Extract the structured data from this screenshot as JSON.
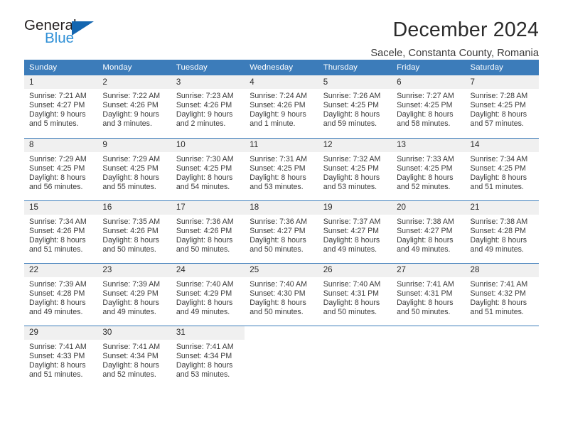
{
  "brand": {
    "logo_general": "General",
    "logo_blue": "Blue",
    "accent_color": "#3c7cba",
    "logo_blue_color": "#2e8fd6",
    "logo_triangle_color": "#1466b0"
  },
  "header": {
    "title": "December 2024",
    "subtitle": "Sacele, Constanta County, Romania"
  },
  "calendar": {
    "weekday_headers": [
      "Sunday",
      "Monday",
      "Tuesday",
      "Wednesday",
      "Thursday",
      "Friday",
      "Saturday"
    ],
    "weeks": [
      [
        {
          "day": "1",
          "sunrise": "Sunrise: 7:21 AM",
          "sunset": "Sunset: 4:27 PM",
          "daylight_line1": "Daylight: 9 hours",
          "daylight_line2": "and 5 minutes."
        },
        {
          "day": "2",
          "sunrise": "Sunrise: 7:22 AM",
          "sunset": "Sunset: 4:26 PM",
          "daylight_line1": "Daylight: 9 hours",
          "daylight_line2": "and 3 minutes."
        },
        {
          "day": "3",
          "sunrise": "Sunrise: 7:23 AM",
          "sunset": "Sunset: 4:26 PM",
          "daylight_line1": "Daylight: 9 hours",
          "daylight_line2": "and 2 minutes."
        },
        {
          "day": "4",
          "sunrise": "Sunrise: 7:24 AM",
          "sunset": "Sunset: 4:26 PM",
          "daylight_line1": "Daylight: 9 hours",
          "daylight_line2": "and 1 minute."
        },
        {
          "day": "5",
          "sunrise": "Sunrise: 7:26 AM",
          "sunset": "Sunset: 4:25 PM",
          "daylight_line1": "Daylight: 8 hours",
          "daylight_line2": "and 59 minutes."
        },
        {
          "day": "6",
          "sunrise": "Sunrise: 7:27 AM",
          "sunset": "Sunset: 4:25 PM",
          "daylight_line1": "Daylight: 8 hours",
          "daylight_line2": "and 58 minutes."
        },
        {
          "day": "7",
          "sunrise": "Sunrise: 7:28 AM",
          "sunset": "Sunset: 4:25 PM",
          "daylight_line1": "Daylight: 8 hours",
          "daylight_line2": "and 57 minutes."
        }
      ],
      [
        {
          "day": "8",
          "sunrise": "Sunrise: 7:29 AM",
          "sunset": "Sunset: 4:25 PM",
          "daylight_line1": "Daylight: 8 hours",
          "daylight_line2": "and 56 minutes."
        },
        {
          "day": "9",
          "sunrise": "Sunrise: 7:29 AM",
          "sunset": "Sunset: 4:25 PM",
          "daylight_line1": "Daylight: 8 hours",
          "daylight_line2": "and 55 minutes."
        },
        {
          "day": "10",
          "sunrise": "Sunrise: 7:30 AM",
          "sunset": "Sunset: 4:25 PM",
          "daylight_line1": "Daylight: 8 hours",
          "daylight_line2": "and 54 minutes."
        },
        {
          "day": "11",
          "sunrise": "Sunrise: 7:31 AM",
          "sunset": "Sunset: 4:25 PM",
          "daylight_line1": "Daylight: 8 hours",
          "daylight_line2": "and 53 minutes."
        },
        {
          "day": "12",
          "sunrise": "Sunrise: 7:32 AM",
          "sunset": "Sunset: 4:25 PM",
          "daylight_line1": "Daylight: 8 hours",
          "daylight_line2": "and 53 minutes."
        },
        {
          "day": "13",
          "sunrise": "Sunrise: 7:33 AM",
          "sunset": "Sunset: 4:25 PM",
          "daylight_line1": "Daylight: 8 hours",
          "daylight_line2": "and 52 minutes."
        },
        {
          "day": "14",
          "sunrise": "Sunrise: 7:34 AM",
          "sunset": "Sunset: 4:25 PM",
          "daylight_line1": "Daylight: 8 hours",
          "daylight_line2": "and 51 minutes."
        }
      ],
      [
        {
          "day": "15",
          "sunrise": "Sunrise: 7:34 AM",
          "sunset": "Sunset: 4:26 PM",
          "daylight_line1": "Daylight: 8 hours",
          "daylight_line2": "and 51 minutes."
        },
        {
          "day": "16",
          "sunrise": "Sunrise: 7:35 AM",
          "sunset": "Sunset: 4:26 PM",
          "daylight_line1": "Daylight: 8 hours",
          "daylight_line2": "and 50 minutes."
        },
        {
          "day": "17",
          "sunrise": "Sunrise: 7:36 AM",
          "sunset": "Sunset: 4:26 PM",
          "daylight_line1": "Daylight: 8 hours",
          "daylight_line2": "and 50 minutes."
        },
        {
          "day": "18",
          "sunrise": "Sunrise: 7:36 AM",
          "sunset": "Sunset: 4:27 PM",
          "daylight_line1": "Daylight: 8 hours",
          "daylight_line2": "and 50 minutes."
        },
        {
          "day": "19",
          "sunrise": "Sunrise: 7:37 AM",
          "sunset": "Sunset: 4:27 PM",
          "daylight_line1": "Daylight: 8 hours",
          "daylight_line2": "and 49 minutes."
        },
        {
          "day": "20",
          "sunrise": "Sunrise: 7:38 AM",
          "sunset": "Sunset: 4:27 PM",
          "daylight_line1": "Daylight: 8 hours",
          "daylight_line2": "and 49 minutes."
        },
        {
          "day": "21",
          "sunrise": "Sunrise: 7:38 AM",
          "sunset": "Sunset: 4:28 PM",
          "daylight_line1": "Daylight: 8 hours",
          "daylight_line2": "and 49 minutes."
        }
      ],
      [
        {
          "day": "22",
          "sunrise": "Sunrise: 7:39 AM",
          "sunset": "Sunset: 4:28 PM",
          "daylight_line1": "Daylight: 8 hours",
          "daylight_line2": "and 49 minutes."
        },
        {
          "day": "23",
          "sunrise": "Sunrise: 7:39 AM",
          "sunset": "Sunset: 4:29 PM",
          "daylight_line1": "Daylight: 8 hours",
          "daylight_line2": "and 49 minutes."
        },
        {
          "day": "24",
          "sunrise": "Sunrise: 7:40 AM",
          "sunset": "Sunset: 4:29 PM",
          "daylight_line1": "Daylight: 8 hours",
          "daylight_line2": "and 49 minutes."
        },
        {
          "day": "25",
          "sunrise": "Sunrise: 7:40 AM",
          "sunset": "Sunset: 4:30 PM",
          "daylight_line1": "Daylight: 8 hours",
          "daylight_line2": "and 50 minutes."
        },
        {
          "day": "26",
          "sunrise": "Sunrise: 7:40 AM",
          "sunset": "Sunset: 4:31 PM",
          "daylight_line1": "Daylight: 8 hours",
          "daylight_line2": "and 50 minutes."
        },
        {
          "day": "27",
          "sunrise": "Sunrise: 7:41 AM",
          "sunset": "Sunset: 4:31 PM",
          "daylight_line1": "Daylight: 8 hours",
          "daylight_line2": "and 50 minutes."
        },
        {
          "day": "28",
          "sunrise": "Sunrise: 7:41 AM",
          "sunset": "Sunset: 4:32 PM",
          "daylight_line1": "Daylight: 8 hours",
          "daylight_line2": "and 51 minutes."
        }
      ],
      [
        {
          "day": "29",
          "sunrise": "Sunrise: 7:41 AM",
          "sunset": "Sunset: 4:33 PM",
          "daylight_line1": "Daylight: 8 hours",
          "daylight_line2": "and 51 minutes."
        },
        {
          "day": "30",
          "sunrise": "Sunrise: 7:41 AM",
          "sunset": "Sunset: 4:34 PM",
          "daylight_line1": "Daylight: 8 hours",
          "daylight_line2": "and 52 minutes."
        },
        {
          "day": "31",
          "sunrise": "Sunrise: 7:41 AM",
          "sunset": "Sunset: 4:34 PM",
          "daylight_line1": "Daylight: 8 hours",
          "daylight_line2": "and 53 minutes."
        },
        {
          "day": "",
          "sunrise": "",
          "sunset": "",
          "daylight_line1": "",
          "daylight_line2": ""
        },
        {
          "day": "",
          "sunrise": "",
          "sunset": "",
          "daylight_line1": "",
          "daylight_line2": ""
        },
        {
          "day": "",
          "sunrise": "",
          "sunset": "",
          "daylight_line1": "",
          "daylight_line2": ""
        },
        {
          "day": "",
          "sunrise": "",
          "sunset": "",
          "daylight_line1": "",
          "daylight_line2": ""
        }
      ]
    ]
  }
}
